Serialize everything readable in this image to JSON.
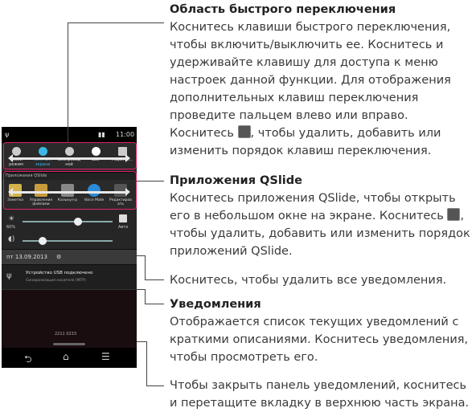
{
  "phone": {
    "status_time": "11:00",
    "quick_keys": [
      "Тихий режим",
      "Тёмн-ент экрана",
      "Беспровод ной",
      "LED",
      "Редакти..."
    ],
    "qslide_header": "Приложения QSlide",
    "qslide_apps": [
      "Заметка",
      "Управление файлами",
      "Калькул-р",
      "Voice Mate",
      "Редактиров ать"
    ],
    "brightness_label": "60%",
    "brightness_auto": "Авто",
    "brightness_level": 0.62,
    "volume_level": 0.22,
    "date": "пт 13.09.2013",
    "notification_title": "Устройство USB подключено",
    "notification_sub": "Синхронизация носителя (MTP)",
    "home_clock": "2211 0233"
  },
  "callouts": {
    "quick_title": "Область быстрого переключения",
    "quick_text": "Коснитесь клавиши быстрого переключения, чтобы включить/выключить ее. Коснитесь и удерживайте клавишу для доступа к меню настроек данной функции. Для отображения дополнительных клавиш переключения проведите пальцем влево или вправо.",
    "quick_text2_a": "Коснитесь",
    "quick_text2_b": ", чтобы удалить, добавить или изменить порядок клавиш переключения.",
    "qslide_title": "Приложения QSlide",
    "qslide_text_a": "Коснитесь приложения QSlide, чтобы открыть его в небольшом окне на экране. Коснитесь",
    "qslide_text_b": ", чтобы удалить, добавить или изменить порядок приложений QSlide.",
    "clear_text": "Коснитесь, чтобы удалить все уведомления.",
    "notif_title": "Уведомления",
    "notif_text": "Отображается список текущих уведомлений с краткими описаниями. Коснитесь уведомления, чтобы просмотреть его.",
    "close_text": "Чтобы закрыть панель уведомлений, коснитесь и перетащите вкладку в верхнюю часть экрана."
  },
  "colors": {
    "highlight": "#e0206a",
    "text": "#3a3a3a"
  }
}
